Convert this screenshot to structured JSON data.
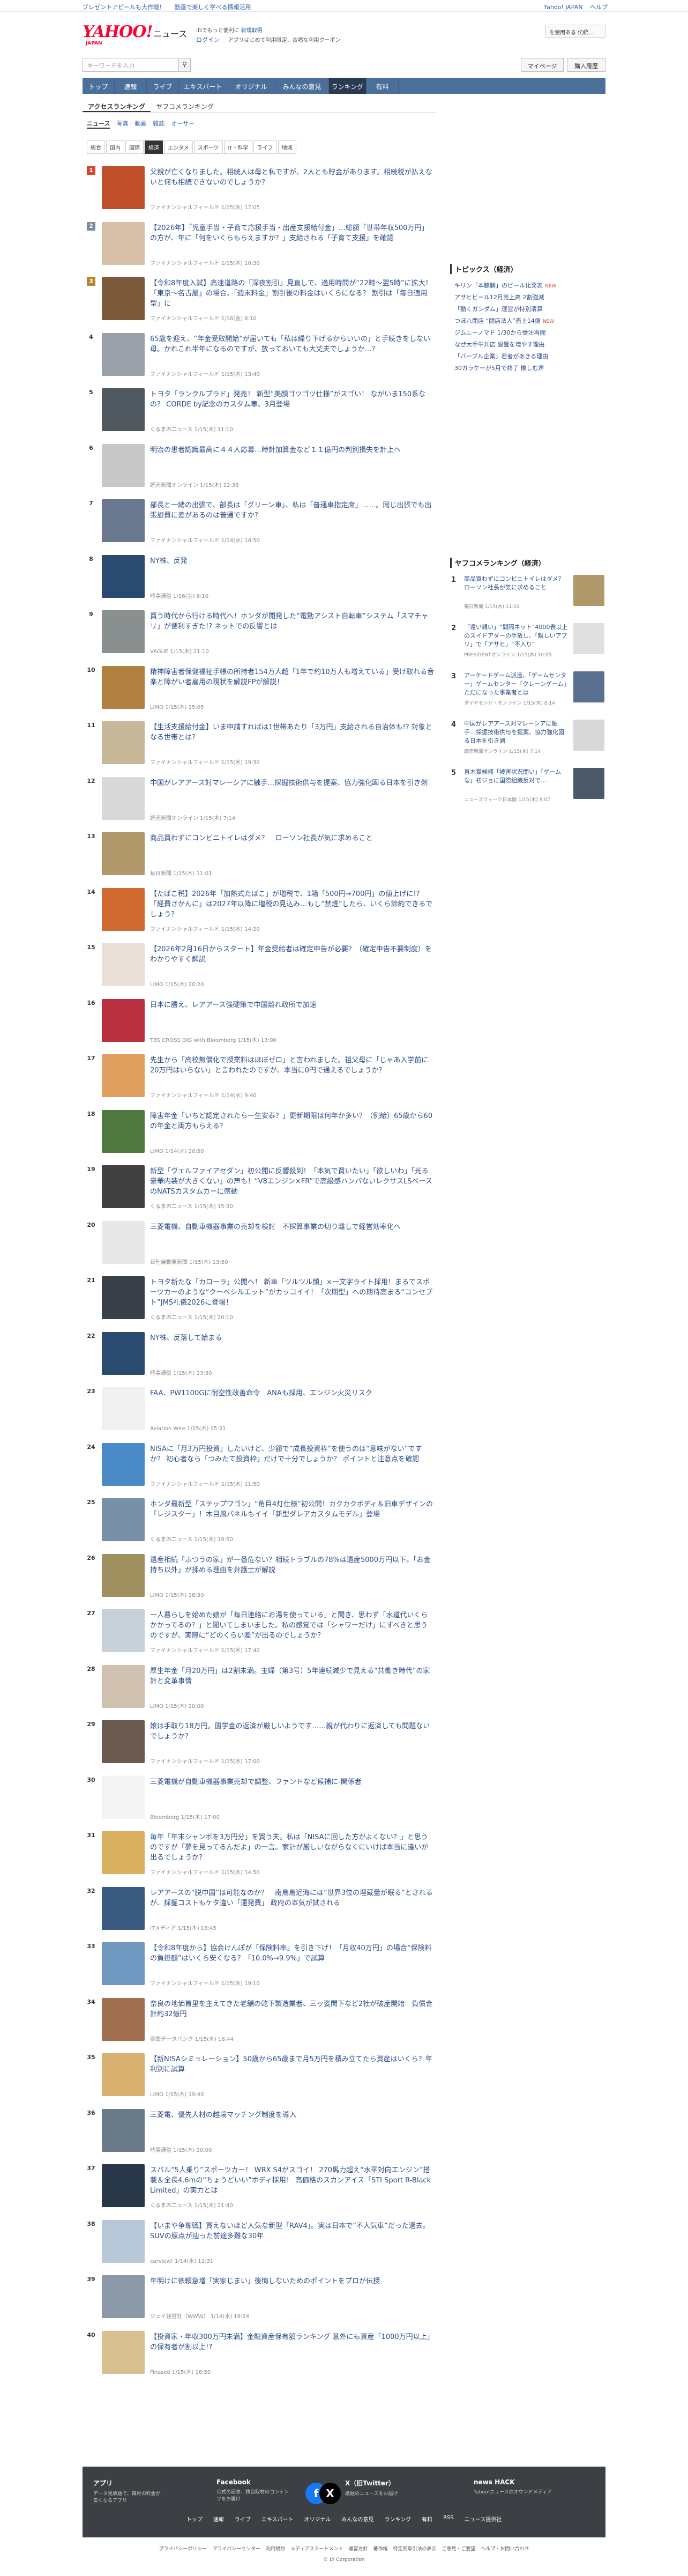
{
  "topbar": {
    "promo": [
      "ブレゼントアピールも大作戦！",
      "動画で楽しく学べる情報活用"
    ],
    "util": [
      "Yahoo! JAPAN",
      "ヘルプ"
    ]
  },
  "header": {
    "logo": "YAHOO!",
    "logo_sub": "JAPAN",
    "news": "ニュース",
    "tagline_prefix": "IDでもっと便利に",
    "tagline_reg": "新規取得",
    "login": "ログイン",
    "login_note": "アプリはじめて利用限定、合唱な利用クーポン",
    "coupon": "を使用ある 伝統..."
  },
  "search": {
    "placeholder": "キーワードを入力",
    "mypage": "マイページ",
    "register": "購入履歴"
  },
  "nav": [
    "トップ",
    "速報",
    "ライブ",
    "エキスパート",
    "オリジナル",
    "みんなの意見",
    "ランキング",
    "有料"
  ],
  "nav_active": 6,
  "rank_tabs": [
    "アクセスランキング",
    "ヤフコメランキング"
  ],
  "sub_tabs": [
    "ニュース",
    "写真",
    "動画",
    "雑誌",
    "オーサー"
  ],
  "genre_tabs": [
    "総合",
    "国内",
    "国際",
    "経済",
    "エンタメ",
    "スポーツ",
    "IT・科学",
    "ライフ",
    "地域"
  ],
  "genre_active": 3,
  "colors": {
    "nav": "#4a6f9a",
    "accent": "#ff0033",
    "link": "#2b4e8a"
  },
  "ranking": [
    {
      "n": "1",
      "title": "父親が亡くなりました。相続人は母と私ですが、2人とも貯金があります。相続税が払えないと何も相続できないのでしょうか？",
      "meta": "ファイナンシャルフィールド 1/15(木) 17:05",
      "c": "#c0502a"
    },
    {
      "n": "2",
      "title": "【2026年】「児童手当・子育て応援手当・出産支援給付金」…総額「世帯年収500万円」の方が、年に「何をいくらもらえますか？」支給される「子育て支援」を確認",
      "meta": "ファイナンシャルフィールド 1/15(木) 10:30",
      "c": "#d8c0a8"
    },
    {
      "n": "3",
      "title": "【令和8年度入試】高速道路の「深夜割引」見直しで、適用時間が“22時～翌5時”に拡大！「東京～名古屋」の場合、「週末料金」割引後の料金はいくらになる？ 割引は「毎日適用型」に",
      "meta": "ファイナンシャルフィールド 1/16(金) 8:10",
      "c": "#7a5a3a"
    },
    {
      "n": "4",
      "title": "65歳を迎え、“年金受取開始”が届いても「私は繰り下げるからいいの」と手続きをしない母。かれこれ半年になるのですが、放っておいても大丈夫でしょうか…？",
      "meta": "ファイナンシャルフィールド 1/15(木) 13:40",
      "c": "#9aa0a8"
    },
    {
      "n": "5",
      "title": "トヨタ「ランクルプラド」発売！ 新型“美顔ゴツゴツ仕様”がスゴい！ ながいま150系なの？ CORDE by記念のカスタム車、3月登場",
      "meta": "くるまのニュース 1/15(木) 11:10",
      "c": "#505860"
    },
    {
      "n": "6",
      "title": "明治の患者認識最高に４４人応募…時計加算金など１１億円の判別損失を計上へ",
      "meta": "読売新聞オンライン 1/15(木) 22:36",
      "c": "#c8c8c8"
    },
    {
      "n": "7",
      "title": "部長と一緒の出張で、部長は「グリーン車」、私は「普通車指定席」……。同じ出張でも出張旅費に差があるのは普通ですか？",
      "meta": "ファイナンシャルフィールド 1/14(水) 16:50",
      "c": "#6a7890"
    },
    {
      "n": "8",
      "title": "NY株、反発",
      "meta": "時事通信 1/16(金) 6:10",
      "c": "#2a4a70"
    },
    {
      "n": "9",
      "title": "買う時代から行ける時代へ！ホンダが開発した“電動アシスト自転車”システム「スマチャリ」が便利すぎた!? ネットでの反響とは",
      "meta": "VAGUE 1/15(木) 21:10",
      "c": "#8a9090"
    },
    {
      "n": "10",
      "title": "精神障害者保健福祉手帳の所持者154万人超「1年で約10万人も増えている」受け取れる音楽と障がい者雇用の現状を解説FPが解説！",
      "meta": "LIMO 1/15(木) 15:05",
      "c": "#b08040"
    },
    {
      "n": "11",
      "title": "【生活支援給付金】いま申請すればは1世帯あたり「3万円」支給される自治体も!? 対象となる世帯とは？",
      "meta": "ファイナンシャルフィールド 1/15(木) 19:30",
      "c": "#c8b89a"
    },
    {
      "n": "12",
      "title": "中国がレアアース対マレーシアに触手…採掘技術供与を提案、協力強化図る日本を引き剥",
      "meta": "読売新聞オンライン 1/15(木) 7:14",
      "c": "#d8d8d8"
    },
    {
      "n": "13",
      "title": "商品買わずにコンビニトイレはダメ？　ローソン社長が気に求めること",
      "meta": "毎日新聞 1/15(木) 11:01",
      "c": "#b0986a"
    },
    {
      "n": "14",
      "title": "【たばこ税】2026年「加熱式たばこ」が増税で、1箱「500円→700円」の値上げに!? 「経費さかんに」は2027年以降に増税の見込み…もし“禁煙”したら、いくら節約できるでしょう？",
      "meta": "ファイナンシャルフィールド 1/15(木) 14:20",
      "c": "#d06a30"
    },
    {
      "n": "15",
      "title": "【2026年2月16日からスタート】年金受給者は確定申告が必要？（確定申告不要制度）をわかりやすく解説",
      "meta": "LIMO 1/15(木) 20:20",
      "c": "#e8e0d8"
    },
    {
      "n": "16",
      "title": "日本に勝え、レアアース強硬策で中国離れ政所で加速",
      "meta": "TBS CROSS DIG with Bloomberg 1/15(木) 13:00",
      "c": "#b83040"
    },
    {
      "n": "17",
      "title": "先生から「高校無償化で授業料はほぼゼロ」と言われました。祖父母に「じゃあ入学前に20万円はいらない」と言われたのですが、本当に0円で通えるでしょうか？",
      "meta": "ファイナンシャルフィールド 1/14(水) 9:40",
      "c": "#e0a060"
    },
    {
      "n": "18",
      "title": "障害年金「いちど認定されたら一生安泰？」更新期限は何年か多い？（例給）65歳から60の年金と両方もらえる？",
      "meta": "LIMO 1/14(水) 20:50",
      "c": "#507840"
    },
    {
      "n": "19",
      "title": "新型「ヴェルファイアセダン」初公開に反響殺到！「本気で買いたい」「欲しいわ」「光る豪華内装が大きくない」の声も！“V8エンジン×FR”で高級感ハンパないレクサスLSベースのNATSカスタムカーに感動",
      "meta": "くるまのニュース 1/15(木) 15:30",
      "c": "#404040"
    },
    {
      "n": "20",
      "title": "三菱電機、自動車機器事業の売却を検討　不採算事業の切り離しで経営効率化へ",
      "meta": "日刊自動車新聞 1/15(木) 13:50",
      "c": "#e8e8e8"
    },
    {
      "n": "21",
      "title": "トヨタ新たな「カローラ」公開へ！ 新車「ツルツル顔」×一文字ライト採用！まるでスポーツカーのような“クーペシルエット”がカッコイイ！「次期型」への期待高まる“コンセプト”JMS礼儀2026に登場！",
      "meta": "くるまのニュース 1/15(木) 20:10",
      "c": "#3a4048"
    },
    {
      "n": "22",
      "title": "NY株、反落して始まる",
      "meta": "時事通信 1/15(木) 23:30",
      "c": "#2a4a70"
    },
    {
      "n": "23",
      "title": "FAA、PW1100Gに耐空性改善命令　ANAも採用、エンジン火災リスク",
      "meta": "Aviation Wire 1/15(木) 15:31",
      "c": "#f0f0f0"
    },
    {
      "n": "24",
      "title": "NISAに「月3万円投資」したいけど、少額で“成長投資枠”を使うのは“意味がない”ですか？ 初心者なら「つみたて投資枠」だけで十分でしょうか？ ポイントと注意点を確認",
      "meta": "ファイナンシャルフィールド 1/15(木) 11:50",
      "c": "#4a8ac8"
    },
    {
      "n": "25",
      "title": "ホンダ最新型「ステップワゴン」“角目4灯仕様”初公開！カクカクボディ＆旧車デザインの「レジスター」！木目風パネルもイイ「新型ダレアカスタムモデル」登場",
      "meta": "くるまのニュース 1/15(木) 19:50",
      "c": "#7890a8"
    },
    {
      "n": "26",
      "title": "遺産相続「ふつうの家」が一番危ない？相続トラブルの78%は遺産5000万円以下。「お金持ち以外」が揉める理由を弁護士が解説",
      "meta": "LIMO 1/15(木) 18:30",
      "c": "#a09060"
    },
    {
      "n": "27",
      "title": "一人暮らしを始めた娘が「毎日連絡にお湯を使っている」と聞き、思わず「水道代いくらかかってるの？」と聞いてしまいました。私の感覚では「シャワーだけ」にすべきと思うのですが、実際に“どのくらい差”が出るのでしょうか？",
      "meta": "ファイナンシャルフィールド 1/15(木) 17:40",
      "c": "#c8d0d8"
    },
    {
      "n": "28",
      "title": "厚生年金「月20万円」は2割未満。主婦（第3号）5年連続減少で見える“共働き時代”の家計と変革事情",
      "meta": "LIMO 1/15(木) 20:00",
      "c": "#d0c0b0"
    },
    {
      "n": "29",
      "title": "娘は手取り18万円。国学金の返済が厳しいようです……親が代わりに返済しても問題ないでしょうか？",
      "meta": "ファイナンシャルフィールド 1/15(木) 17:00",
      "c": "#6a5a50"
    },
    {
      "n": "30",
      "title": "三菱電機が自動車機器事業売却で調整、ファンドなど候補に-関係者",
      "meta": "Bloomberg 1/15(木) 17:00",
      "c": "#f4f4f4"
    },
    {
      "n": "31",
      "title": "毎年「年末ジャンボを3万円分」を買う夫。私は「NISAに回した方がよくない？」と思うのですが「夢を見ってるんだよ」の一言。家計が厳しいながらなくにいけば本当に違いが出るでしょうか？",
      "meta": "ファイナンシャルフィールド 1/15(木) 14:50",
      "c": "#d8b060"
    },
    {
      "n": "32",
      "title": "レアアースの“脱中国”は可能なのか？　南鳥島近海には“世界3位の埋蔵量が眠る”とされるが、採掘コストもケタ違い「運発費」 政府の本気が試される",
      "meta": "ITメディア 1/15(木) 18:45",
      "c": "#3a5a80"
    },
    {
      "n": "33",
      "title": "【令和8年度から】協会けんぽが「保険料率」を引き下げ！「月収40万円」の場合“保険料の負担額”はいくら安くなる？「10.0%→9.9%」で試算",
      "meta": "ファイナンシャルフィールド 1/15(木) 19:10",
      "c": "#7098c0"
    },
    {
      "n": "34",
      "title": "奈良の地価首里を主えてきた老舗の乾下製造業者、三ッ姿間下など2社が破産開始　負債合計約32億円",
      "meta": "帝国データバンク 1/15(木) 16:44",
      "c": "#a07050"
    },
    {
      "n": "35",
      "title": "【新NISAシミュレーション】50歳から65歳まで月5万円を積み立てたら資産はいくら？年利別に試算",
      "meta": "LIMO 1/15(木) 19:40",
      "c": "#d8b070"
    },
    {
      "n": "36",
      "title": "三菱電、優先人材の越境マッチング制度を導入",
      "meta": "時事通信 1/15(木) 20:00",
      "c": "#6a7a88"
    },
    {
      "n": "37",
      "title": "スバル“5人乗り”スポーツカー！ WRX S4がスゴイ！ 270馬力超え“水平対向エンジン”搭載＆全長4.6mの“ちょうどいい”ボディ採用！ 高価格のスカンアイス「STI Sport R-Black Limited」の実力とは",
      "meta": "くるまのニュース 1/15(木) 21:40",
      "c": "#283848"
    },
    {
      "n": "38",
      "title": "【いまや争奪戦】買えないほど人気な新型「RAV4」。実は日本で“不人気車”だった過去。SUVの原点が辿った前途多難な30年",
      "meta": "carview! 1/14(水) 11:31",
      "c": "#b8c8d8"
    },
    {
      "n": "39",
      "title": "年明けに依頼急増「実家じまい」後悔しないためのポイントをプロが伝授",
      "meta": "ジェイ経営社（WWW） 1/14(水) 19:24",
      "c": "#8a98a8"
    },
    {
      "n": "40",
      "title": "【投資家・年収300万円未満】金融資産保有額ランキング 意外にも資産「1000万円以上」の保有者が割以上!?",
      "meta": "Finasee 1/15(木) 18:50",
      "c": "#d8c090"
    }
  ],
  "topics": {
    "title": "トピックス（経済）",
    "items": [
      {
        "t": "キリン「本麒麟」のビール化発表",
        "mark": "NEW"
      },
      {
        "t": "アサヒビール12月売上高 2割強減",
        "mark": ""
      },
      {
        "t": "「動くガンダム」運営が特別清算",
        "mark": ""
      },
      {
        "t": "つぼ八閉店 “閉店法人”売上14億",
        "mark": "NEW"
      },
      {
        "t": "ジムニーノマド 1/30から受注再開",
        "mark": ""
      },
      {
        "t": "なぜ大手牛丼店 設置を増やす理由",
        "mark": ""
      },
      {
        "t": "「バーブル企業」若者があきる理由",
        "mark": ""
      },
      {
        "t": "30ガラケーが5月で終了 懐しむ声",
        "mark": ""
      }
    ]
  },
  "side_ranking": {
    "title": "ヤフコメランキング（経済）",
    "items": [
      {
        "n": "1",
        "title": "商品買わずにコンビニトイレはダメ？　ローソン社長が気に求めること",
        "meta": "毎日新聞 1/15(木) 11:01",
        "c": "#b0986a"
      },
      {
        "n": "2",
        "title": "「遠い親い」“間隔ネット”4000表以上のスイドアダーの手放し、「親しいアプリ」で「アサヒ」“不入り”",
        "meta": "PRESIDENTオンライン 1/15(木) 10:05",
        "c": "#e0e0e0"
      },
      {
        "n": "3",
        "title": "アーケードゲーム派遣、「ゲームセンター」ゲームセンター「クレーンゲーム」ただになった事業者とは",
        "meta": "ダイヤモンド・オンライン 1/15(木) 8:14",
        "c": "#5a7090"
      },
      {
        "n": "4",
        "title": "中国がレアアース対マレーシアに触手…採掘技術供与を提案、協力強化図る日本を引き剥",
        "meta": "読売新聞オンライン 1/15(木) 7:14",
        "c": "#d8d8d8"
      },
      {
        "n": "5",
        "title": "直木賞候補「被害状況関い」「ゲームな」初ジョに国際組織反対で…",
        "meta": "ニューズウィーク日本版 1/15(木) 8:07",
        "c": "#4a5868"
      }
    ]
  },
  "footer": {
    "blocks": [
      {
        "title": "アプリ",
        "desc": "データ見放題で、毎月の料金が安くなるアプリ"
      },
      {
        "title": "Facebook",
        "desc": "公式の記事、独自取材のコンテンツをお届け"
      },
      {
        "title": "X（旧Twitter）",
        "desc": "話題のニュースをお届け"
      },
      {
        "title": "news HACK",
        "desc": "Yahoo!ニュースのオウンドメディア"
      }
    ],
    "links": [
      "トップ",
      "速報",
      "ライブ",
      "エキスパート",
      "オリジナル",
      "みんなの意見",
      "ランキング",
      "有料",
      "RSS",
      "ニュース提供社"
    ],
    "bottom_links": [
      "プライバシーポリシー",
      "プライバシーセンター",
      "利用規約",
      "メディアステートメント",
      "運営方針",
      "著作権",
      "特定商取引法の表示",
      "ご意見・ご要望",
      "ヘルプ・お問い合わせ"
    ],
    "copyright": "© LY Corporation"
  }
}
